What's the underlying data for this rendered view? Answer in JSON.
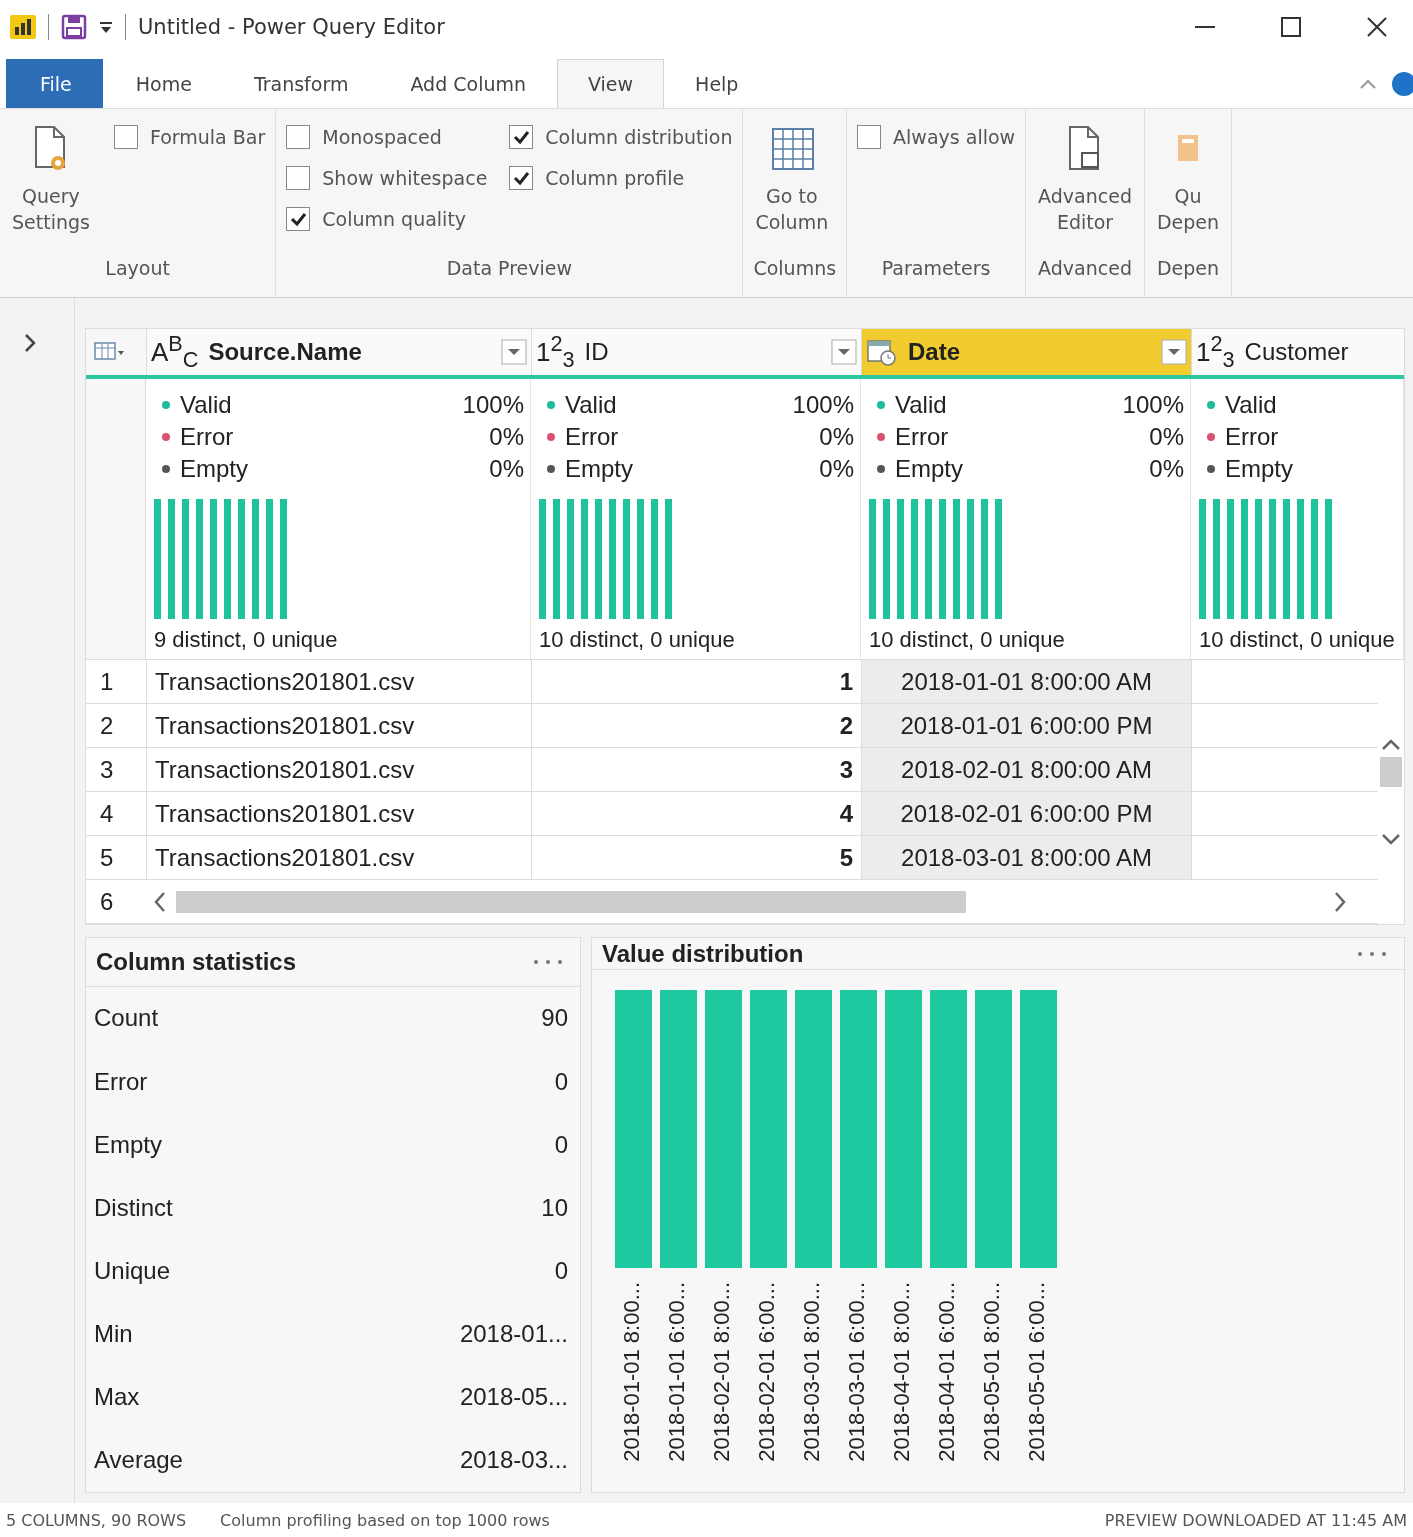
{
  "window": {
    "title": "Untitled - Power Query Editor"
  },
  "tabs": [
    {
      "label": "File",
      "kind": "file",
      "selected": false
    },
    {
      "label": "Home",
      "kind": "tab",
      "selected": false
    },
    {
      "label": "Transform",
      "kind": "tab",
      "selected": false
    },
    {
      "label": "Add Column",
      "kind": "tab",
      "selected": false
    },
    {
      "label": "View",
      "kind": "tab",
      "selected": true
    },
    {
      "label": "Help",
      "kind": "tab",
      "selected": false
    }
  ],
  "ribbon": {
    "groups": [
      {
        "label": "Layout",
        "items": [
          {
            "kind": "settings_button",
            "lines": [
              "Query",
              "Settings"
            ]
          },
          {
            "kind": "checks",
            "checks": [
              {
                "label": "Formula Bar",
                "checked": false
              }
            ]
          }
        ]
      },
      {
        "label": "Data Preview",
        "items": [
          {
            "kind": "checks",
            "checks": [
              {
                "label": "Monospaced",
                "checked": false
              },
              {
                "label": "Show whitespace",
                "checked": false
              },
              {
                "label": "Column quality",
                "checked": true
              }
            ]
          },
          {
            "kind": "checks",
            "checks": [
              {
                "label": "Column distribution",
                "checked": true
              },
              {
                "label": "Column profile",
                "checked": true
              }
            ]
          }
        ]
      },
      {
        "label": "Columns",
        "items": [
          {
            "kind": "grid_button",
            "lines": [
              "Go to",
              "Column"
            ]
          }
        ]
      },
      {
        "label": "Parameters",
        "items": [
          {
            "kind": "checks",
            "checks": [
              {
                "label": "Always allow",
                "checked": false
              }
            ]
          }
        ]
      },
      {
        "label": "Advanced",
        "items": [
          {
            "kind": "editor_button",
            "lines": [
              "Advanced",
              "Editor"
            ]
          }
        ]
      },
      {
        "label": "Depen",
        "items": [
          {
            "kind": "dependency_button",
            "lines": [
              "Qu",
              "Depen"
            ]
          }
        ]
      }
    ]
  },
  "grid": {
    "columns": [
      {
        "kind": "text",
        "type_label": "A$^{B}$$_{C}$",
        "name": "Source.Name",
        "selected": false,
        "quality": [
          {
            "label": "Valid",
            "value": "100%",
            "color": "#1abc9c"
          },
          {
            "label": "Error",
            "value": "0%",
            "color": "#d9536f"
          },
          {
            "label": "Empty",
            "value": "0%",
            "color": "#555555"
          }
        ],
        "distinct": "9 distinct, 0 unique"
      },
      {
        "kind": "number",
        "type_label": "1$^{2}$$_{3}$",
        "name": "ID",
        "selected": false,
        "quality": [
          {
            "label": "Valid",
            "value": "100%",
            "color": "#1abc9c"
          },
          {
            "label": "Error",
            "value": "0%",
            "color": "#d9536f"
          },
          {
            "label": "Empty",
            "value": "0%",
            "color": "#555555"
          }
        ],
        "distinct": "10 distinct, 0 unique"
      },
      {
        "kind": "datetime",
        "name": "Date",
        "selected": true,
        "quality": [
          {
            "label": "Valid",
            "value": "100%",
            "color": "#1abc9c"
          },
          {
            "label": "Error",
            "value": "0%",
            "color": "#d9536f"
          },
          {
            "label": "Empty",
            "value": "0%",
            "color": "#555555"
          }
        ],
        "distinct": "10 distinct, 0 unique"
      },
      {
        "kind": "number",
        "type_label": "1$^{2}$$_{3}$",
        "name": "Customer",
        "selected": false,
        "quality": [
          {
            "label": "Valid",
            "color": "#1abc9c"
          },
          {
            "label": "Error",
            "color": "#d9536f"
          },
          {
            "label": "Empty",
            "color": "#555555"
          }
        ],
        "distinct": "10 distinct, 0 unique"
      }
    ],
    "rows": [
      {
        "number": "1",
        "cells": [
          "Transactions201801.csv",
          "1",
          "2018-01-01 8:00:00 AM"
        ]
      },
      {
        "number": "2",
        "cells": [
          "Transactions201801.csv",
          "2",
          "2018-01-01 6:00:00 PM"
        ]
      },
      {
        "number": "3",
        "cells": [
          "Transactions201801.csv",
          "3",
          "2018-02-01 8:00:00 AM"
        ]
      },
      {
        "number": "4",
        "cells": [
          "Transactions201801.csv",
          "4",
          "2018-02-01 6:00:00 PM"
        ]
      },
      {
        "number": "5",
        "cells": [
          "Transactions201801.csv",
          "5",
          "2018-03-01 8:00:00 AM"
        ]
      },
      {
        "number": "6",
        "cells": []
      }
    ]
  },
  "column_statistics": {
    "title": "Column statistics",
    "rows": [
      {
        "label": "Count",
        "value": "90"
      },
      {
        "label": "Error",
        "value": "0"
      },
      {
        "label": "Empty",
        "value": "0"
      },
      {
        "label": "Distinct",
        "value": "10"
      },
      {
        "label": "Unique",
        "value": "0"
      },
      {
        "label": "Min",
        "value": "2018-01..."
      },
      {
        "label": "Max",
        "value": "2018-05..."
      },
      {
        "label": "Average",
        "value": "2018-03..."
      }
    ]
  },
  "value_distribution": {
    "title": "Value distribution",
    "bar_labels": [
      "2018-01-01 8:00...",
      "2018-01-01 6:00...",
      "2018-02-01 8:00...",
      "2018-02-01 6:00...",
      "2018-03-01 8:00...",
      "2018-03-01 6:00...",
      "2018-04-01 8:00...",
      "2018-04-01 6:00...",
      "2018-05-01 8:00...",
      "2018-05-01 6:00..."
    ]
  },
  "status_bar": {
    "left": [
      "5 COLUMNS, 90 ROWS",
      "Column profiling based on top 1000 rows"
    ],
    "right": "PREVIEW DOWNLOADED AT 11:45 AM"
  }
}
